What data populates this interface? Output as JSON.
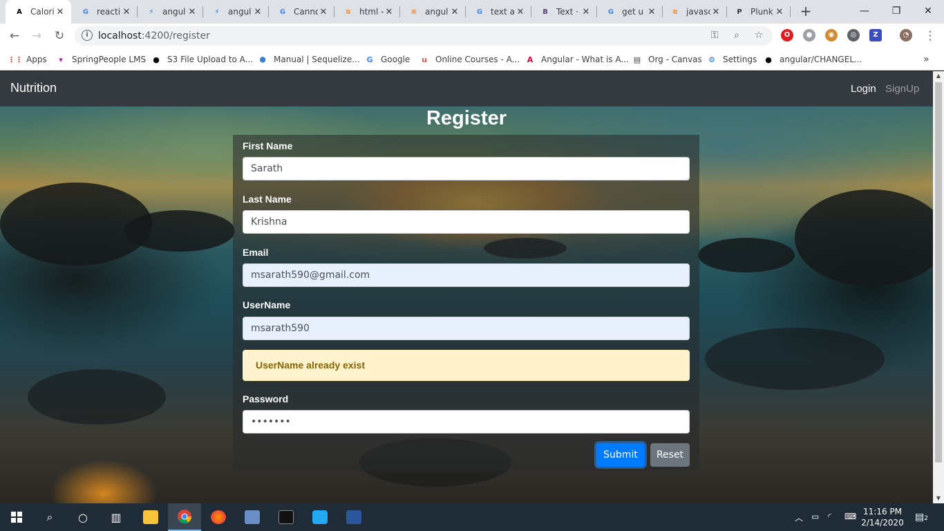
{
  "browser": {
    "tabs": [
      {
        "title": "Calori",
        "favicon": "angular-icon",
        "color": "#000000",
        "glyph": "A"
      },
      {
        "title": "reacti",
        "favicon": "google-icon",
        "color": "#4285f4",
        "glyph": "G"
      },
      {
        "title": "angul",
        "favicon": "bolt-icon",
        "color": "#1a73e8",
        "glyph": "⚡"
      },
      {
        "title": "angul",
        "favicon": "bolt-icon",
        "color": "#1a73e8",
        "glyph": "⚡"
      },
      {
        "title": "Canno",
        "favicon": "google-icon",
        "color": "#4285f4",
        "glyph": "G"
      },
      {
        "title": "html -",
        "favicon": "stackoverflow-icon",
        "color": "#f48024",
        "glyph": "≋"
      },
      {
        "title": "angul",
        "favicon": "stackoverflow-icon",
        "color": "#f48024",
        "glyph": "≋"
      },
      {
        "title": "text a",
        "favicon": "google-icon",
        "color": "#4285f4",
        "glyph": "G"
      },
      {
        "title": "Text ·",
        "favicon": "bootstrap-icon",
        "color": "#563d7c",
        "glyph": "B"
      },
      {
        "title": "get u",
        "favicon": "google-icon",
        "color": "#4285f4",
        "glyph": "G"
      },
      {
        "title": "javasc",
        "favicon": "stackoverflow-icon",
        "color": "#f48024",
        "glyph": "≋"
      },
      {
        "title": "Plunk",
        "favicon": "plunker-icon",
        "color": "#333333",
        "glyph": "P"
      }
    ],
    "address": {
      "host": "localhost",
      "path": ":4200/register"
    },
    "bookmarks": [
      {
        "label": "Apps",
        "icon": "apps-grid-icon",
        "color": "#ea4335",
        "glyph": "⋮⋮"
      },
      {
        "label": "SpringPeople LMS",
        "icon": "springpeople-icon",
        "color": "#9c27b0",
        "glyph": "▾"
      },
      {
        "label": "S3 File Upload to A...",
        "icon": "github-icon",
        "color": "#000000",
        "glyph": "●"
      },
      {
        "label": "Manual | Sequelize...",
        "icon": "sequelize-icon",
        "color": "#3b7fd1",
        "glyph": "⬢"
      },
      {
        "label": "Google",
        "icon": "google-icon",
        "color": "#4285f4",
        "glyph": "G"
      },
      {
        "label": "Online Courses - A...",
        "icon": "udemy-icon",
        "color": "#ec5252",
        "glyph": "u"
      },
      {
        "label": "Angular - What is A...",
        "icon": "angular-icon",
        "color": "#dd0031",
        "glyph": "A"
      },
      {
        "label": "Org - Canvas",
        "icon": "document-icon",
        "color": "#3c4043",
        "glyph": "▤"
      },
      {
        "label": "Settings",
        "icon": "gear-icon",
        "color": "#1a73e8",
        "glyph": "⚙"
      },
      {
        "label": "angular/CHANGEL...",
        "icon": "github-icon",
        "color": "#000000",
        "glyph": "●"
      }
    ]
  },
  "app": {
    "brand": "Nutrition",
    "nav": {
      "login": "Login",
      "signup": "SignUp"
    },
    "form": {
      "title": "Register",
      "first_name": {
        "label": "First Name",
        "value": "Sarath"
      },
      "last_name": {
        "label": "Last Name",
        "value": "Krishna"
      },
      "email": {
        "label": "Email",
        "value": "msarath590@gmail.com"
      },
      "username": {
        "label": "UserName",
        "value": "msarath590"
      },
      "alert": "UserName already exist",
      "password": {
        "label": "Password",
        "value": "•••••••"
      },
      "submit": "Submit",
      "reset": "Reset"
    }
  },
  "taskbar": {
    "time": "11:16 PM",
    "date": "2/14/2020",
    "notifications": "2"
  },
  "colors": {
    "navbar": "#343a40",
    "primary": "#007bff",
    "secondary": "#6c757d",
    "warning_bg": "#fff3cd",
    "warning_text": "#856404"
  }
}
